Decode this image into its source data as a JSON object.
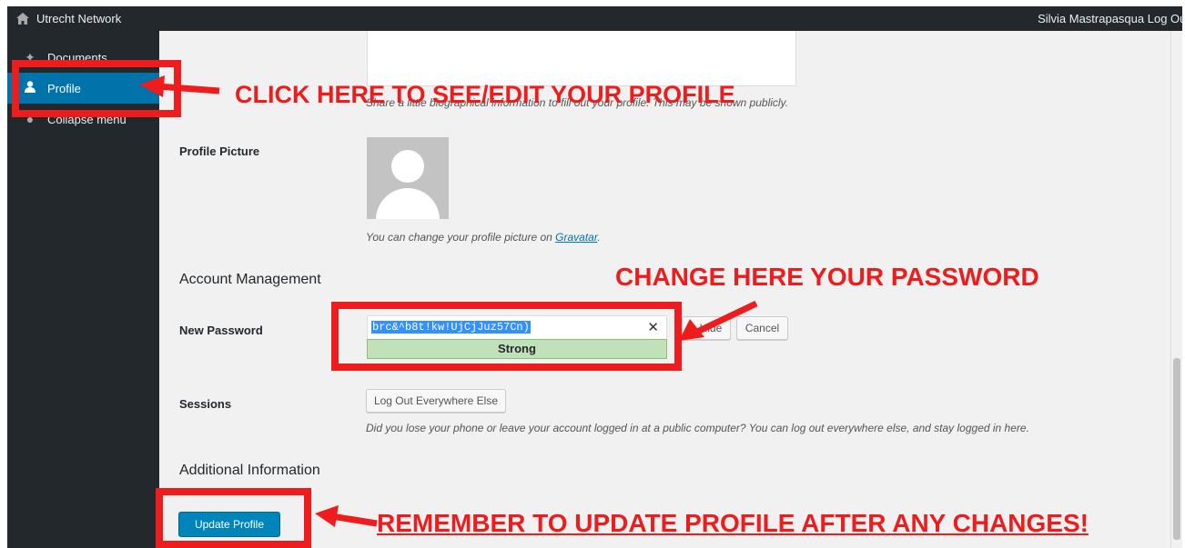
{
  "admin_bar": {
    "site_name": "Utrecht Network",
    "user_text": "Silvia Mastrapasqua Log Out"
  },
  "sidebar": {
    "items": [
      {
        "label": "Documents",
        "icon": "pin-icon"
      },
      {
        "label": "Profile",
        "icon": "user-icon"
      },
      {
        "label": "Collapse menu",
        "icon": "collapse-icon"
      }
    ]
  },
  "bio": {
    "description": "Share a little biographical information to fill out your profile. This may be shown publicly."
  },
  "profile_picture": {
    "label": "Profile Picture",
    "description_prefix": "You can change your profile picture on ",
    "link_text": "Gravatar",
    "description_suffix": "."
  },
  "account_management": {
    "title": "Account Management",
    "new_password_label": "New Password",
    "password_value": "brc&^b8t!kw!UjCjJuz57Cn)",
    "strength": "Strong",
    "hide_label": "Hide",
    "cancel_label": "Cancel",
    "sessions_label": "Sessions",
    "logout_else_label": "Log Out Everywhere Else",
    "sessions_description": "Did you lose your phone or leave your account logged in at a public computer? You can log out everywhere else, and stay logged in here."
  },
  "additional_information": {
    "title": "Additional Information",
    "update_label": "Update Profile"
  },
  "annotations": {
    "profile": "CLICK HERE TO SEE/EDIT YOUR PROFILE",
    "password": "CHANGE HERE YOUR PASSWORD",
    "update": "REMEMBER TO UPDATE PROFILE AFTER ANY CHANGES!"
  },
  "colors": {
    "admin_bar": "#23282d",
    "accent": "#0073aa",
    "annotation_red": "#ee1c1c",
    "strength_green": "#c1e1b9"
  }
}
